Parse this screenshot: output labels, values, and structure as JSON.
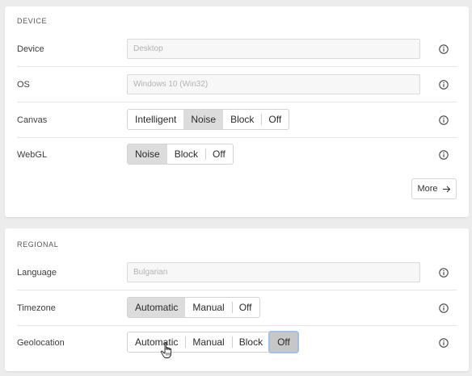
{
  "device": {
    "title": "DEVICE",
    "rows": {
      "device": {
        "label": "Device",
        "value": "Desktop"
      },
      "os": {
        "label": "OS",
        "value": "Windows 10 (Win32)"
      },
      "canvas": {
        "label": "Canvas",
        "options": [
          "Intelligent",
          "Noise",
          "Block",
          "Off"
        ],
        "selected": "Noise"
      },
      "webgl": {
        "label": "WebGL",
        "options": [
          "Noise",
          "Block",
          "Off"
        ],
        "selected": "Noise"
      }
    },
    "more_label": "More"
  },
  "regional": {
    "title": "REGIONAL",
    "rows": {
      "language": {
        "label": "Language",
        "value": "Bulgarian"
      },
      "timezone": {
        "label": "Timezone",
        "options": [
          "Automatic",
          "Manual",
          "Off"
        ],
        "selected": "Automatic"
      },
      "geolocation": {
        "label": "Geolocation",
        "options": [
          "Automatic",
          "Manual",
          "Block",
          "Off"
        ],
        "selected": "Off"
      }
    }
  },
  "icons": {
    "info": "info-circle-icon",
    "arrow": "arrow-right-icon",
    "cursor": "hand-pointer-icon"
  },
  "colors": {
    "background": "#ececec",
    "card": "#ffffff",
    "selected": "#dcdcdc",
    "focus_ring": "#9dc0ea"
  }
}
